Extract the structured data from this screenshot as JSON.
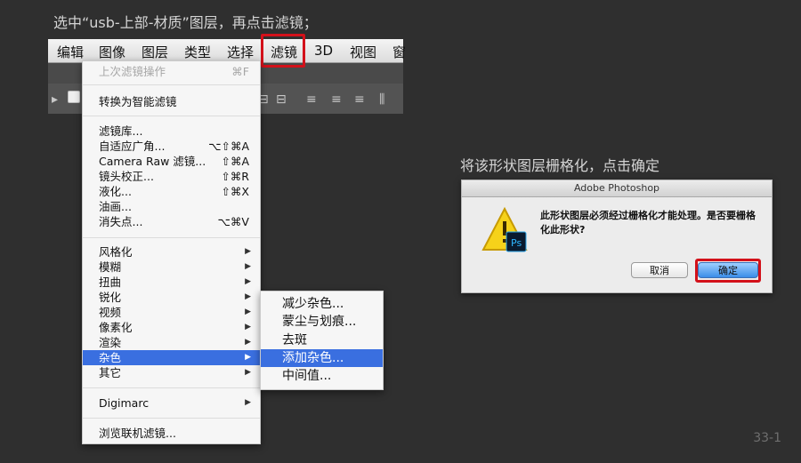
{
  "captions": {
    "step1": "选中“usb-上部-材质”图层，再点击滤镜；",
    "step2": "将该形状图层栅格化，点击确定"
  },
  "page_number": "33-1",
  "menubar": {
    "items": [
      "编辑",
      "图像",
      "图层",
      "类型",
      "选择",
      "滤镜",
      "3D",
      "视图",
      "窗"
    ],
    "highlighted": "滤镜",
    "highlight_color": "#d3111a"
  },
  "filter_menu": {
    "items": [
      {
        "label": "上次滤镜操作",
        "shortcut": "⌘F",
        "disabled": true
      },
      {
        "label": "转换为智能滤镜",
        "shortcut": ""
      },
      {
        "label": "滤镜库...",
        "shortcut": ""
      },
      {
        "label": "自适应广角...",
        "shortcut": "⌥⇧⌘A"
      },
      {
        "label": "Camera Raw 滤镜...",
        "shortcut": "⇧⌘A"
      },
      {
        "label": "镜头校正...",
        "shortcut": "⇧⌘R"
      },
      {
        "label": "液化...",
        "shortcut": "⇧⌘X"
      },
      {
        "label": "油画...",
        "shortcut": ""
      },
      {
        "label": "消失点...",
        "shortcut": "⌥⌘V"
      },
      {
        "label": "风格化",
        "submenu": true
      },
      {
        "label": "模糊",
        "submenu": true
      },
      {
        "label": "扭曲",
        "submenu": true
      },
      {
        "label": "锐化",
        "submenu": true
      },
      {
        "label": "视频",
        "submenu": true
      },
      {
        "label": "像素化",
        "submenu": true
      },
      {
        "label": "渲染",
        "submenu": true
      },
      {
        "label": "杂色",
        "submenu": true,
        "selected": true
      },
      {
        "label": "其它",
        "submenu": true
      },
      {
        "label": "Digimarc",
        "submenu": true
      },
      {
        "label": "浏览联机滤镜...",
        "shortcut": ""
      }
    ],
    "arrow_glyph": "▶"
  },
  "noise_submenu": {
    "items": [
      {
        "label": "减少杂色..."
      },
      {
        "label": "蒙尘与划痕..."
      },
      {
        "label": "去斑"
      },
      {
        "label": "添加杂色...",
        "selected": true
      },
      {
        "label": "中间值..."
      }
    ]
  },
  "dialog": {
    "title": "Adobe Photoshop",
    "icon": "warning-photoshop-icon",
    "icon_badge": "Ps",
    "message": "此形状图层必须经过栅格化才能处理。是否要栅格化此形状?",
    "cancel_label": "取消",
    "ok_label": "确定",
    "accent": "#3a8de8"
  }
}
